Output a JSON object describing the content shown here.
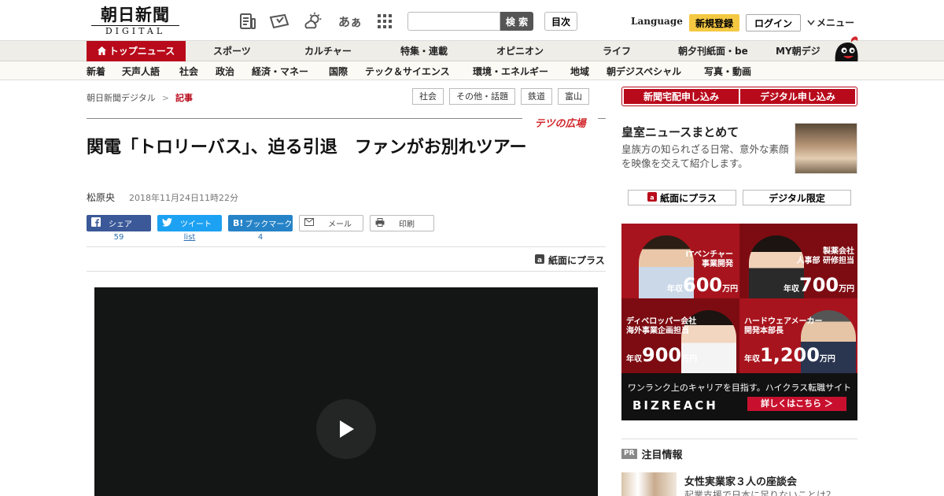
{
  "header": {
    "logo_jp": "朝日新聞",
    "logo_en": "DIGITAL",
    "font_size_icon_label": "あぁ",
    "search_placeholder": "",
    "search_button": "検 索",
    "toc_button": "目次",
    "language": "Language",
    "register": "新規登録",
    "login": "ログイン",
    "menu": "メニュー"
  },
  "nav": {
    "items": [
      "トップニュース",
      "スポーツ",
      "カルチャー",
      "特集・連載",
      "オピニオン",
      "ライフ",
      "朝夕刊紙面・be",
      "MY朝デジ"
    ]
  },
  "subnav": {
    "items": [
      "新着",
      "天声人語",
      "社会",
      "政治",
      "経済・マネー",
      "国際",
      "テック＆サイエンス",
      "環境・エネルギー",
      "地域",
      "朝デジスペシャル",
      "写真・動画"
    ]
  },
  "breadcrumb": {
    "root": "朝日新聞デジタル",
    "separator": ">",
    "current": "記事"
  },
  "tags": [
    "社会",
    "その他・話題",
    "鉄道",
    "富山"
  ],
  "article": {
    "rubric": "テツの広場",
    "title": "関電「トロリーバス」、迫る引退　ファンがお別れツアー",
    "author": "松原央",
    "date": "2018年11月24日11時22分",
    "share": {
      "facebook": "シェア",
      "facebook_count": "59",
      "twitter": "ツイート",
      "twitter_count": "list",
      "hatena_icon": "B!",
      "hatena": "ブックマーク",
      "hatena_count": "4",
      "mail": "メール",
      "print": "印刷"
    },
    "paper_plus": "紙面にプラス"
  },
  "sidebar": {
    "subscribe_paper": "新聞宅配申し込み",
    "subscribe_digital": "デジタル申し込み",
    "promo_title": "皇室ニュースまとめて",
    "promo_desc": "皇族方の知られざる日常、意外な素顔を映像を交えて紹介します。",
    "paper_plus": "紙面にプラス",
    "digital_only": "デジタル限定",
    "ad": {
      "cells": [
        {
          "role1": "ITベンチャー",
          "role2": "事業開発",
          "label": "年収",
          "amount": "600",
          "unit": "万円"
        },
        {
          "role1": "製薬会社",
          "role2": "人事部 研修担当",
          "label": "年収",
          "amount": "700",
          "unit": "万円"
        },
        {
          "role1": "ディベロッパー会社",
          "role2": "海外事業企画担当",
          "label": "年収",
          "amount": "900",
          "unit": "万円"
        },
        {
          "role1": "ハードウェアメーカー",
          "role2": "開発本部長",
          "label": "年収",
          "amount": "1,200",
          "unit": "万円"
        }
      ],
      "slogan": "ワンランク上のキャリアを目指す。ハイクラス転職サイト",
      "brand": "BIZREACH",
      "cta": "詳しくはこちら ＞"
    },
    "attention_badge": "PR",
    "attention_title": "注目情報",
    "attention_item_title": "女性実業家３人の座談会",
    "attention_item_sub": "起業支援で日本に足りないことは？"
  },
  "colors": {
    "brand_red": "#b80a1b",
    "register_yellow": "#f5c842",
    "facebook": "#3b5998",
    "twitter": "#1da1f2",
    "hatena": "#2683c7"
  }
}
